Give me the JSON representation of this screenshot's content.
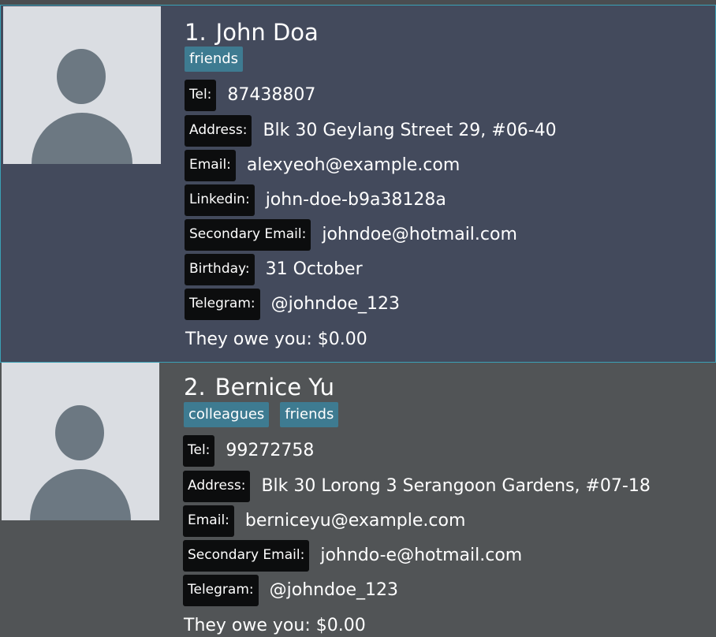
{
  "contacts": [
    {
      "index": "1.",
      "name": "John Doa",
      "tags": [
        "friends"
      ],
      "fields": [
        {
          "label": "Tel:",
          "value": "87438807"
        },
        {
          "label": "Address:",
          "value": "Blk 30 Geylang Street 29, #06-40"
        },
        {
          "label": "Email:",
          "value": "alexyeoh@example.com"
        },
        {
          "label": "Linkedin:",
          "value": "john-doe-b9a38128a"
        },
        {
          "label": "Secondary Email:",
          "value": "johndoe@hotmail.com"
        },
        {
          "label": "Birthday:",
          "value": "31 October"
        },
        {
          "label": "Telegram:",
          "value": "@johndoe_123"
        }
      ],
      "owe": "They owe you: $0.00"
    },
    {
      "index": "2.",
      "name": "Bernice Yu",
      "tags": [
        "colleagues",
        "friends"
      ],
      "fields": [
        {
          "label": "Tel:",
          "value": "99272758"
        },
        {
          "label": "Address:",
          "value": "Blk 30 Lorong 3 Serangoon Gardens, #07-18"
        },
        {
          "label": "Email:",
          "value": "berniceyu@example.com"
        },
        {
          "label": "Secondary Email:",
          "value": "johndo-e@hotmail.com"
        },
        {
          "label": "Telegram:",
          "value": "@johndoe_123"
        }
      ],
      "owe": "They owe you: $0.00"
    }
  ]
}
